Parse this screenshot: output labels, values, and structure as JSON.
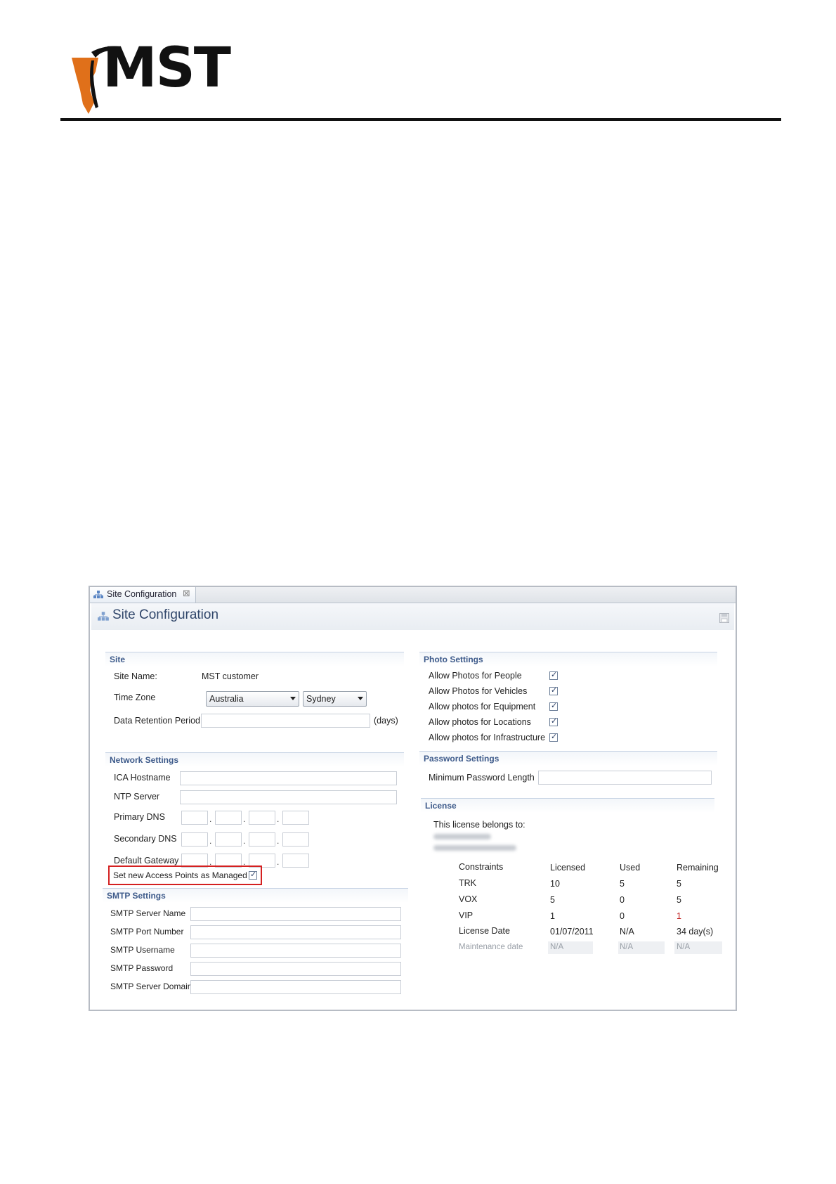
{
  "logo": {
    "text": "MST",
    "accent_color": "#e0701a"
  },
  "window": {
    "tab_label": "Site Configuration",
    "page_title": "Site Configuration"
  },
  "site": {
    "section_title": "Site",
    "site_name_label": "Site Name:",
    "site_name_value": "MST  customer",
    "time_zone_label": "Time Zone",
    "time_zone_region": "Australia",
    "time_zone_city": "Sydney",
    "retention_label": "Data Retention Period",
    "retention_unit": "(days)"
  },
  "network": {
    "section_title": "Network Settings",
    "ica_hostname_label": "ICA Hostname",
    "ntp_server_label": "NTP Server",
    "primary_dns_label": "Primary DNS",
    "secondary_dns_label": "Secondary DNS",
    "default_gateway_label": "Default Gateway",
    "ip_separator": ".",
    "managed_label": "Set new Access Points as Managed",
    "managed_checked": true
  },
  "smtp": {
    "section_title": "SMTP Settings",
    "server_name_label": "SMTP Server Name",
    "port_label": "SMTP Port Number",
    "username_label": "SMTP Username",
    "password_label": "SMTP Password",
    "domain_label": "SMTP Server Domain"
  },
  "photo": {
    "section_title": "Photo Settings",
    "items": [
      {
        "label": "Allow Photos for People",
        "checked": true
      },
      {
        "label": "Allow Photos for Vehicles",
        "checked": true
      },
      {
        "label": "Allow photos for Equipment",
        "checked": true
      },
      {
        "label": "Allow photos for Locations",
        "checked": true
      },
      {
        "label": "Allow photos for Infrastructure",
        "checked": true
      }
    ]
  },
  "password": {
    "section_title": "Password Settings",
    "min_length_label": "Minimum Password Length"
  },
  "license": {
    "section_title": "License",
    "belongs_to_label": "This license belongs to:",
    "headers": [
      "Constraints",
      "Licensed",
      "Used",
      "Remaining"
    ],
    "rows": [
      [
        "TRK",
        "10",
        "5",
        "5"
      ],
      [
        "VOX",
        "5",
        "0",
        "5"
      ],
      [
        "VIP",
        "1",
        "0",
        "1"
      ],
      [
        "License Date",
        "01/07/2011",
        "N/A",
        "34 day(s)"
      ]
    ],
    "maintenance": [
      "Maintenance date",
      "N/A",
      "N/A",
      "N/A"
    ]
  }
}
